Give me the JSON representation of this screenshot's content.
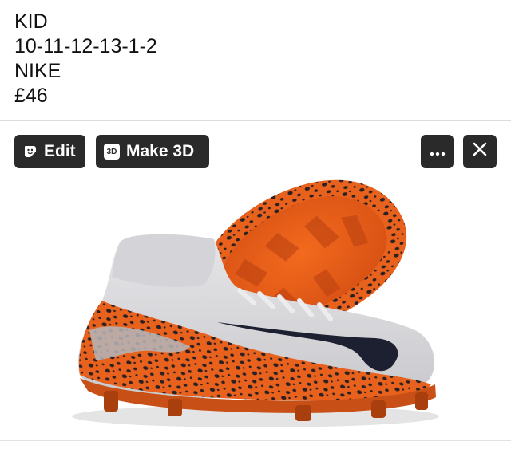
{
  "post": {
    "lines": [
      "KID",
      "10-11-12-13-1-2",
      "NIKE",
      "£46"
    ]
  },
  "toolbar": {
    "edit_label": "Edit",
    "edit_icon": "sticker-edit-icon",
    "make3d_label": "Make 3D",
    "make3d_badge": "3D",
    "make3d_icon": "3d-icon",
    "more_icon": "more-dots-icon",
    "close_icon": "close-icon"
  },
  "image": {
    "subject": "football-boots",
    "colors": {
      "upper": "#d9d9dc",
      "plate": "#e8621e",
      "spots": "#2b2122",
      "swoosh": "#1c2030",
      "button_bg": "#2a2a2a"
    }
  }
}
